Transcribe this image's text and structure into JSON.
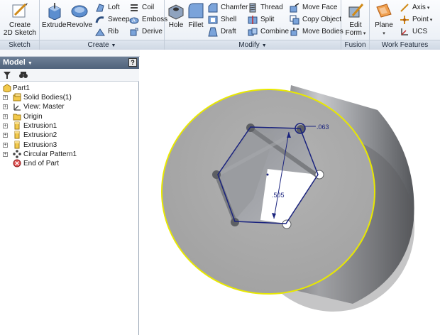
{
  "ribbon": {
    "sketch": {
      "footer": "Sketch",
      "create_2d_sketch": [
        "Create",
        "2D Sketch"
      ]
    },
    "create": {
      "footer": "Create",
      "extrude": "Extrude",
      "revolve": "Revolve",
      "loft": "Loft",
      "sweep": "Sweep",
      "rib": "Rib",
      "coil": "Coil",
      "emboss": "Emboss",
      "derive": "Derive"
    },
    "modify": {
      "footer": "Modify",
      "hole": "Hole",
      "fillet": "Fillet",
      "chamfer": "Chamfer",
      "shell": "Shell",
      "draft": "Draft",
      "thread": "Thread",
      "split": "Split",
      "combine": "Combine",
      "move_face": "Move Face",
      "copy_object": "Copy Object",
      "move_bodies": "Move Bodies"
    },
    "fusion": {
      "footer": "Fusion",
      "edit_form": [
        "Edit",
        "Form"
      ]
    },
    "work_features": {
      "footer": "Work Features",
      "plane": "Plane",
      "axis": "Axis",
      "point": "Point",
      "ucs": "UCS"
    }
  },
  "browser": {
    "title": "Model",
    "help": "?",
    "tree": [
      {
        "label": "Part1",
        "icon": "part-icon"
      },
      {
        "label": "Solid Bodies(1)",
        "icon": "solid-bodies-icon"
      },
      {
        "label": "View: Master",
        "icon": "view-icon"
      },
      {
        "label": "Origin",
        "icon": "folder-icon"
      },
      {
        "label": "Extrusion1",
        "icon": "extrusion-icon"
      },
      {
        "label": "Extrusion2",
        "icon": "extrusion-icon"
      },
      {
        "label": "Extrusion3",
        "icon": "extrusion-icon"
      },
      {
        "label": "Circular Pattern1",
        "icon": "circular-pattern-icon"
      },
      {
        "label": "End of Part",
        "icon": "end-of-part-icon"
      }
    ]
  },
  "viewport": {
    "dim_small": ".063",
    "dim_large": ".505",
    "colors": {
      "face": "#a9a9a9",
      "edge_highlight": "#e8e800",
      "sketch": "#1a237e"
    }
  }
}
